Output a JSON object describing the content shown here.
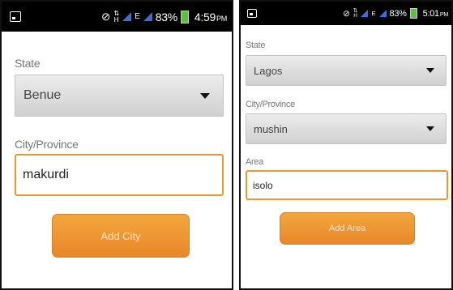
{
  "left_screen": {
    "status_bar": {
      "time": "4:59",
      "ampm": "PM",
      "battery": "83%",
      "network": "E"
    },
    "state_label": "State",
    "state_value": "Benue",
    "city_label": "City/Province",
    "city_input_value": "makurdi",
    "add_button": "Add City"
  },
  "right_screen": {
    "status_bar": {
      "time": "5:01",
      "ampm": "PM",
      "battery": "83%",
      "network": "E"
    },
    "state_label": "State",
    "state_value": "Lagos",
    "city_label": "City/Province",
    "city_value": "mushin",
    "area_label": "Area",
    "area_input_value": "isolo",
    "add_button": "Add Area"
  },
  "colors": {
    "accent_orange": "#e99a32",
    "button": "#f0a03a",
    "signal": "#3b6fd8",
    "battery": "#5cc23c"
  }
}
